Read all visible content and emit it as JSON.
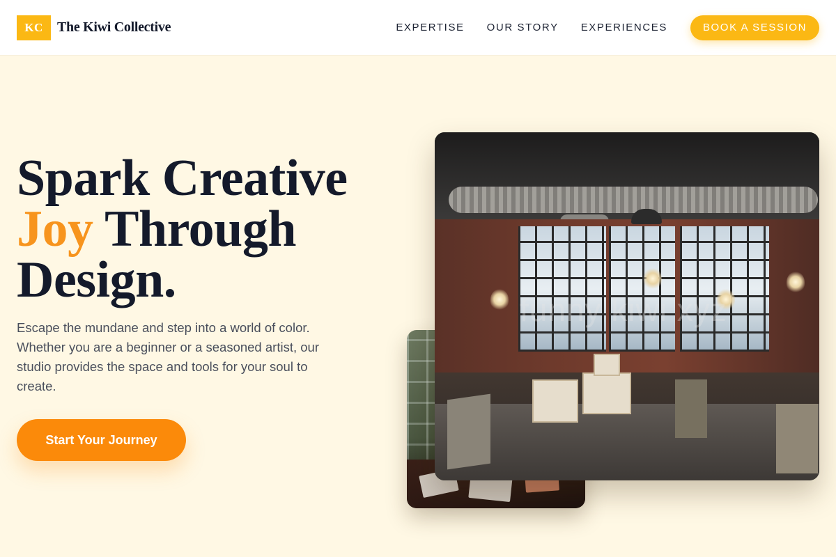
{
  "brand": {
    "logo_mark": "KC",
    "name": "The Kiwi Collective"
  },
  "nav": {
    "links": [
      "EXPERTISE",
      "OUR STORY",
      "EXPERIENCES"
    ],
    "cta_label": "BOOK A SESSION"
  },
  "hero": {
    "title_line1": "Spark Creative",
    "title_accent": "Joy",
    "title_line2_rest": " Through",
    "title_line3": "Design.",
    "description": "Escape the mundane and step into a world of color. Whether you are a beginner or a seasoned artist, our studio provides the space and tools for your soul to create.",
    "cta_label": "Start Your Journey"
  },
  "images": {
    "main_watermark": "funny kiwi xyz"
  },
  "colors": {
    "background": "#fff8e4",
    "brand_yellow": "#fbb814",
    "accent_orange": "#f7941d",
    "cta_orange": "#fb8a0a",
    "heading": "#141a2b"
  }
}
